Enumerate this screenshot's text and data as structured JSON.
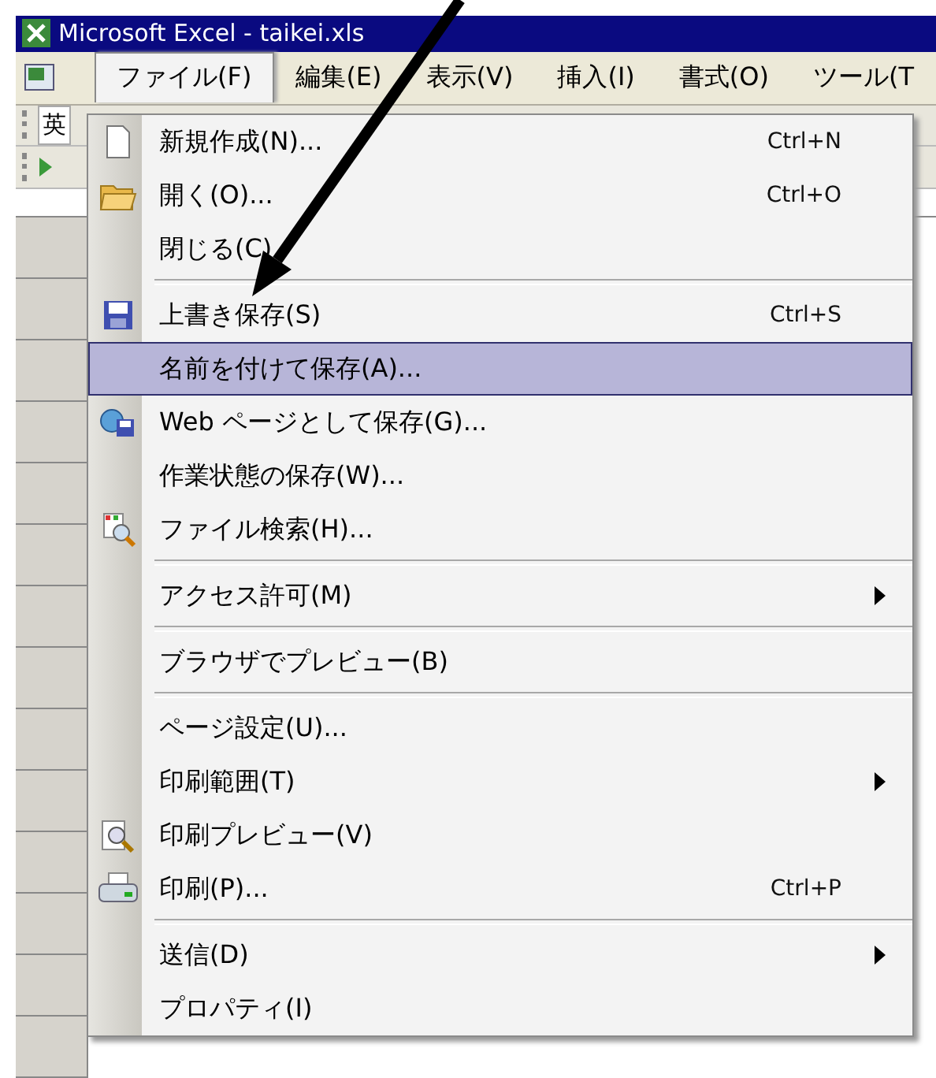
{
  "window": {
    "title": "Microsoft Excel - taikei.xls"
  },
  "menu_bar": [
    {
      "label": "ファイル(F)",
      "selected": true
    },
    {
      "label": "編集(E)",
      "selected": false
    },
    {
      "label": "表示(V)",
      "selected": false
    },
    {
      "label": "挿入(I)",
      "selected": false
    },
    {
      "label": "書式(O)",
      "selected": false
    },
    {
      "label": "ツール(T",
      "selected": false
    }
  ],
  "toolbar": {
    "font_box": "英"
  },
  "file_menu": [
    {
      "label": "新規作成(N)...",
      "shortcut": "Ctrl+N",
      "kind": "new",
      "selected": false
    },
    {
      "label": "開く(O)...",
      "shortcut": "Ctrl+O",
      "kind": "open",
      "selected": false
    },
    {
      "label": "閉じる(C)",
      "selected": false
    },
    {
      "label": "上書き保存(S)",
      "shortcut": "Ctrl+S",
      "kind": "save",
      "selected": false,
      "separator_above": true
    },
    {
      "label": "名前を付けて保存(A)...",
      "selected": true
    },
    {
      "label": "Web ページとして保存(G)...",
      "kind": "web",
      "selected": false
    },
    {
      "label": "作業状態の保存(W)...",
      "selected": false
    },
    {
      "label": "ファイル検索(H)...",
      "kind": "search",
      "selected": false
    },
    {
      "label": "アクセス許可(M)",
      "submenu": true,
      "selected": false,
      "separator_above": true
    },
    {
      "label": "ブラウザでプレビュー(B)",
      "selected": false,
      "separator_above": true
    },
    {
      "label": "ページ設定(U)...",
      "selected": false,
      "separator_above": true
    },
    {
      "label": "印刷範囲(T)",
      "submenu": true,
      "selected": false
    },
    {
      "label": "印刷プレビュー(V)",
      "kind": "preview",
      "selected": false
    },
    {
      "label": "印刷(P)...",
      "shortcut": "Ctrl+P",
      "kind": "print",
      "selected": false
    },
    {
      "label": "送信(D)",
      "submenu": true,
      "selected": false,
      "separator_above": true
    },
    {
      "label": "プロパティ(I)",
      "selected": false
    }
  ]
}
